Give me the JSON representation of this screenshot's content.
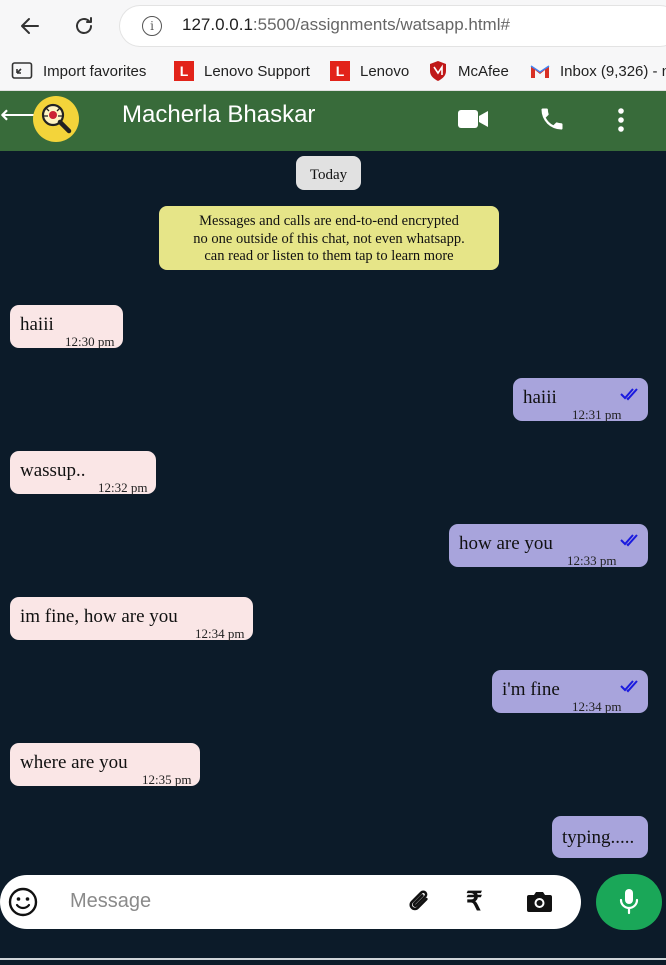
{
  "browser": {
    "url_host": "127.0.0.1",
    "url_rest": ":5500/assignments/watsapp.html#",
    "bookmarks": [
      {
        "label": "Import favorites",
        "icon": "import-icon"
      },
      {
        "label": "Lenovo Support",
        "icon": "lenovo-icon"
      },
      {
        "label": "Lenovo",
        "icon": "lenovo-icon"
      },
      {
        "label": "McAfee",
        "icon": "mcafee-icon"
      },
      {
        "label": "Inbox (9,326) - n",
        "icon": "gmail-icon"
      }
    ]
  },
  "header": {
    "back": "⟵",
    "contact_name": "Macherla Bhaskar"
  },
  "chat": {
    "date_chip": "Today",
    "notice": [
      "Messages and calls are end-to-end encrypted",
      "no one outside of this chat, not even whatsapp.",
      "can read or listen to them tap to learn more"
    ],
    "messages": [
      {
        "dir": "in",
        "text": "haiii",
        "time": "12:30 pm"
      },
      {
        "dir": "out",
        "text": "haiii",
        "time": "12:31 pm",
        "ticks": "read"
      },
      {
        "dir": "in",
        "text": "wassup..",
        "time": "12:32 pm"
      },
      {
        "dir": "out",
        "text": "how are you",
        "time": "12:33 pm",
        "ticks": "read"
      },
      {
        "dir": "in",
        "text": "im fine, how are you",
        "time": "12:34 pm"
      },
      {
        "dir": "out",
        "text": "i'm fine",
        "time": "12:34 pm",
        "ticks": "read"
      },
      {
        "dir": "in",
        "text": "where are you",
        "time": "12:35 pm"
      },
      {
        "dir": "out",
        "text": "typing....."
      }
    ]
  },
  "composer": {
    "placeholder": "Message",
    "rupee": "₹"
  },
  "colors": {
    "header": "#386b3a",
    "background": "#0c1b29",
    "incoming": "#fae6e6",
    "outgoing": "#a8a4dc",
    "notice": "#e6e588",
    "mic": "#1aa758",
    "tick": "#1a1adf"
  }
}
